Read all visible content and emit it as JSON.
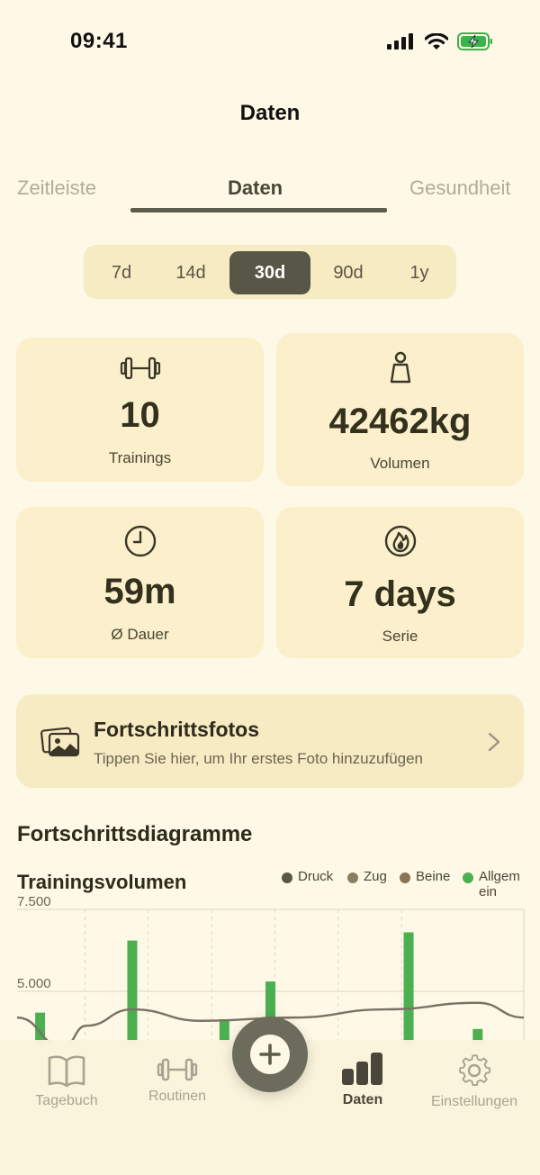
{
  "status": {
    "time": "09:41"
  },
  "header": {
    "title": "Daten"
  },
  "tabs": [
    {
      "label": "Zeitleiste"
    },
    {
      "label": "Daten"
    },
    {
      "label": "Gesundheit"
    }
  ],
  "ranges": [
    "7d",
    "14d",
    "30d",
    "90d",
    "1y"
  ],
  "selected_range": "30d",
  "stats": {
    "trainings": {
      "value": "10",
      "label": "Trainings",
      "icon": "dumbbell-icon"
    },
    "volume": {
      "value": "42462kg",
      "label": "Volumen",
      "icon": "kettlebell-icon"
    },
    "duration": {
      "value": "59m",
      "label": "Ø Dauer",
      "icon": "clock-icon"
    },
    "streak": {
      "value": "7 days",
      "label": "Serie",
      "icon": "flame-icon"
    }
  },
  "photos": {
    "title": "Fortschrittsfotos",
    "subtitle": "Tippen Sie hier, um Ihr erstes Foto hinzuzufügen"
  },
  "charts_section": {
    "title": "Fortschrittsdiagramme"
  },
  "colors": {
    "accent": "#585646",
    "bar": "#4caf50",
    "line": "#7a7264",
    "card": "#fbf0cb",
    "background": "#fef8e6"
  },
  "chart_data": {
    "type": "bar",
    "title": "Trainingsvolumen",
    "legend": [
      {
        "name": "Druck",
        "color": "#585646"
      },
      {
        "name": "Zug",
        "color": "#8b7d62"
      },
      {
        "name": "Beine",
        "color": "#8b7355"
      },
      {
        "name": "Allgemein",
        "color": "#4caf50"
      }
    ],
    "y_ticks": [
      "7.500",
      "5.000"
    ],
    "ylim": [
      3600,
      7500
    ],
    "series": [
      {
        "name": "Allgemein",
        "type": "bar",
        "x": [
          1,
          5,
          9,
          11,
          17,
          20
        ],
        "values": [
          4350,
          6550,
          4150,
          5300,
          6800,
          3850
        ]
      },
      {
        "type": "line",
        "x": [
          0,
          2,
          3,
          5,
          8,
          12,
          16,
          20,
          22
        ],
        "values": [
          4200,
          3300,
          3950,
          4450,
          4100,
          4200,
          4450,
          4650,
          4200
        ]
      }
    ],
    "x_range": [
      0,
      22
    ],
    "grid": true
  },
  "tabbar": {
    "items": [
      {
        "label": "Tagebuch",
        "icon": "book-icon"
      },
      {
        "label": "Routinen",
        "icon": "dumbbell-icon"
      },
      {
        "label": "Daten",
        "icon": "bar-chart-icon"
      },
      {
        "label": "Einstellungen",
        "icon": "gear-icon"
      }
    ],
    "add_icon": "plus-icon"
  }
}
